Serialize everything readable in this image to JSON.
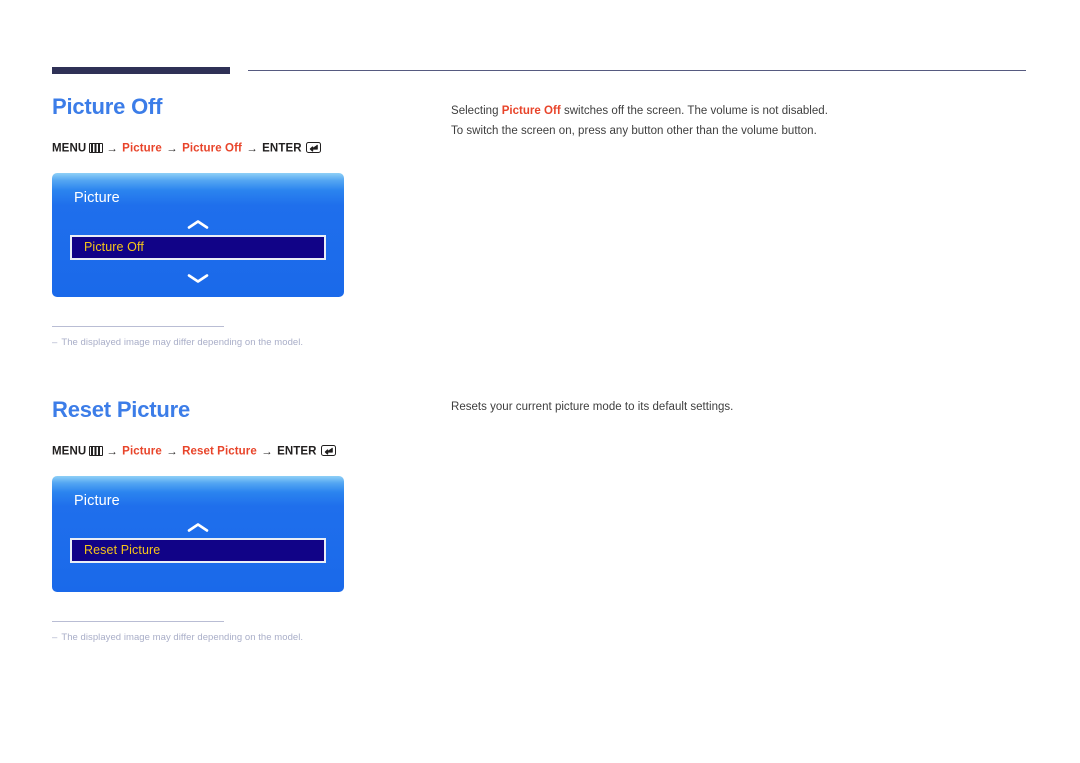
{
  "page": {
    "header_rule": "decorative-rule"
  },
  "sections": [
    {
      "title": "Picture Off",
      "menu_path": {
        "menu_label": "MENU",
        "menu_icon": "menu-bars-icon",
        "arrow": "→",
        "step1": "Picture",
        "step2": "Picture Off",
        "enter_label": "ENTER",
        "enter_icon": "enter-key-icon"
      },
      "osd": {
        "title": "Picture",
        "up_chevron": "chevron-up-icon",
        "selected_item": "Picture Off",
        "down_chevron": "chevron-down-icon",
        "has_down_chevron": true
      },
      "note": {
        "dash": "–",
        "text": "The displayed image may differ depending on the model."
      },
      "description": [
        {
          "parts": [
            {
              "text": "Selecting ",
              "style": "normal"
            },
            {
              "text": "Picture Off",
              "style": "red-bold"
            },
            {
              "text": " switches off the screen. The volume is not disabled.",
              "style": "normal"
            }
          ]
        },
        {
          "parts": [
            {
              "text": "To switch the screen on, press any button other than the volume button.",
              "style": "normal"
            }
          ]
        }
      ]
    },
    {
      "title": "Reset Picture",
      "menu_path": {
        "menu_label": "MENU",
        "menu_icon": "menu-bars-icon",
        "arrow": "→",
        "step1": "Picture",
        "step2": "Reset Picture",
        "enter_label": "ENTER",
        "enter_icon": "enter-key-icon"
      },
      "osd": {
        "title": "Picture",
        "up_chevron": "chevron-up-icon",
        "selected_item": "Reset Picture",
        "down_chevron": null,
        "has_down_chevron": false
      },
      "note": {
        "dash": "–",
        "text": "The displayed image may differ depending on the model."
      },
      "description": [
        {
          "parts": [
            {
              "text": "Resets your current picture mode to its default settings.",
              "style": "normal"
            }
          ]
        }
      ]
    }
  ],
  "colors": {
    "heading_blue": "#3c7de8",
    "path_red": "#e8442a",
    "osd_blue": "#1a69ea",
    "osd_row_navy": "#110387",
    "osd_row_text": "#f5c518",
    "rule_navy": "#2f3156",
    "note_gray": "#a9aec8",
    "body_text": "#3e3e3e"
  }
}
